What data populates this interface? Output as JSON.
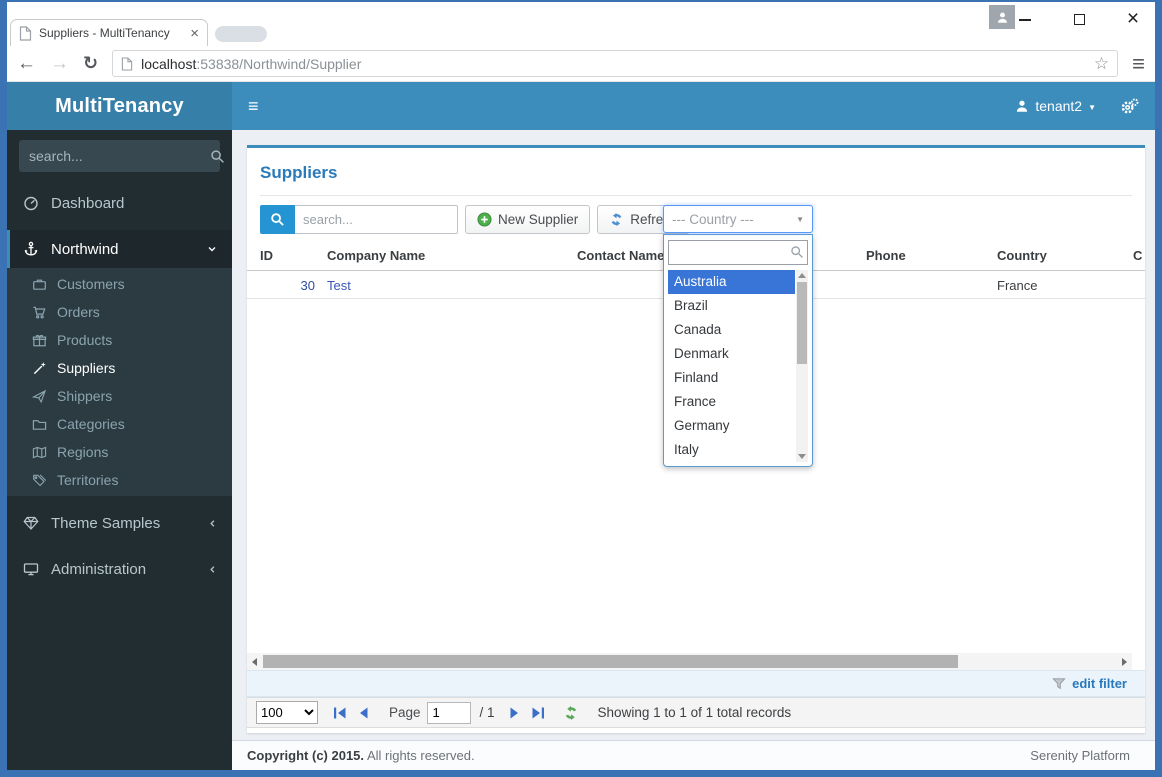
{
  "browser": {
    "tab_title": "Suppliers - MultiTenancy",
    "tab_close_glyph": "×",
    "url_host": "localhost",
    "url_path": ":53838/Northwind/Supplier",
    "back_glyph": "←",
    "forward_glyph": "→",
    "reload_glyph": "↻",
    "star_glyph": "☆",
    "menu_glyph": "≡",
    "window_close_glyph": "×"
  },
  "navbar": {
    "brand": "MultiTenancy",
    "burger_glyph": "≡",
    "user": "tenant2",
    "caret_glyph": "▼"
  },
  "sidebar": {
    "search_placeholder": "search...",
    "dashboard": "Dashboard",
    "northwind": "Northwind",
    "northwind_children": [
      "Customers",
      "Orders",
      "Products",
      "Suppliers",
      "Shippers",
      "Categories",
      "Regions",
      "Territories"
    ],
    "theme_samples": "Theme Samples",
    "administration": "Administration"
  },
  "main": {
    "title": "Suppliers",
    "toolbar": {
      "search_placeholder": "search...",
      "new_supplier": "New Supplier",
      "refresh": "Refresh",
      "country_select": "--- Country ---",
      "country_caret_glyph": "▼"
    },
    "country_dropdown": {
      "options": [
        "Australia",
        "Brazil",
        "Canada",
        "Denmark",
        "Finland",
        "France",
        "Germany",
        "Italy"
      ],
      "highlighted": "Australia"
    },
    "grid": {
      "col_id": "ID",
      "col_company": "Company Name",
      "col_contact": "Contact Name",
      "col_phone": "Phone",
      "col_country": "Country",
      "col_city": "C",
      "row": {
        "id": "30",
        "company": "Test",
        "country": "France"
      }
    },
    "filter": {
      "edit_filter": "edit filter"
    },
    "pager": {
      "size": "100",
      "page_label": "Page",
      "page_value": "1",
      "of_pages": "/ 1",
      "status": "Showing 1 to 1 of 1 total records"
    }
  },
  "footer": {
    "copyright_bold": "Copyright (c) 2015.",
    "copyright_rest": "All rights reserved.",
    "platform": "Serenity Platform"
  },
  "colors": {
    "navbar": "#3c8dbc",
    "brand_bg": "#367fa9",
    "sidebar_bg": "#222d32",
    "submenu_bg": "#2c3b41",
    "select_highlight": "#3875d7",
    "title_blue": "#2a7ab9",
    "new_icon_green": "#4cae4c",
    "refresh_icon_blue": "#4c8fce",
    "refresh_icon_green": "#58a85a"
  }
}
